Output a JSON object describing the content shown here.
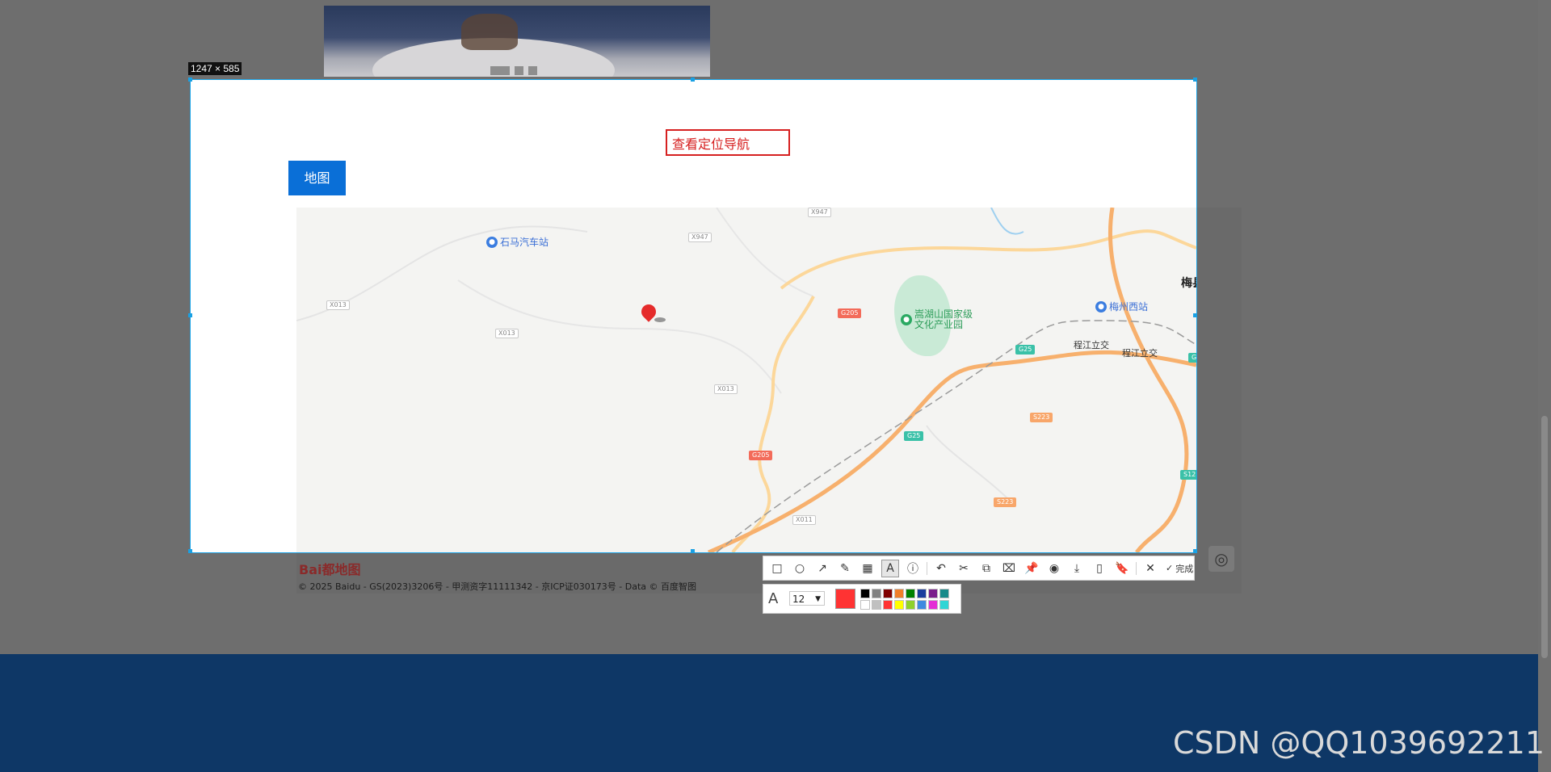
{
  "screenshot_tool": {
    "size_badge": "1247 × 585",
    "toolbar": {
      "tools": [
        {
          "name": "rectangle-icon",
          "glyph": "□"
        },
        {
          "name": "ellipse-icon",
          "glyph": "○"
        },
        {
          "name": "arrow-icon",
          "glyph": "↗"
        },
        {
          "name": "pencil-icon",
          "glyph": "✎"
        },
        {
          "name": "mosaic-icon",
          "glyph": "▦"
        },
        {
          "name": "text-icon",
          "glyph": "A"
        },
        {
          "name": "number-icon",
          "glyph": "ⓘ"
        },
        {
          "name": "undo-icon",
          "glyph": "↶"
        },
        {
          "name": "scissors-icon",
          "glyph": "✂"
        },
        {
          "name": "ocr-icon",
          "glyph": "⧉"
        },
        {
          "name": "translate-icon",
          "glyph": "⌧"
        },
        {
          "name": "pin-icon",
          "glyph": "📌"
        },
        {
          "name": "record-icon",
          "glyph": "◉"
        },
        {
          "name": "download-icon",
          "glyph": "⤓"
        },
        {
          "name": "phone-icon",
          "glyph": "▯"
        },
        {
          "name": "bookmark-icon",
          "glyph": "🔖"
        },
        {
          "name": "close-icon",
          "glyph": "✕"
        }
      ],
      "done_check": "✓",
      "done_label": "完成"
    },
    "text_options": {
      "font_icon": "A",
      "font_size": "12",
      "current_color": "#ff3333",
      "swatches": [
        "#000000",
        "#808080",
        "#800000",
        "#f07f2a",
        "#008000",
        "#1a3e9e",
        "#7a1f8c",
        "#188a8a",
        "#ffffff",
        "#c0c0c0",
        "#ff3333",
        "#ffff00",
        "#8fd12b",
        "#3f8ae0",
        "#e42fd5",
        "#2fd5d5"
      ]
    }
  },
  "page": {
    "nav_text": "查看定位导航",
    "map_button": "地图",
    "map": {
      "places": [
        "梅县区",
        "程江立交",
        "程江立交"
      ],
      "pois": [
        "石马汽车站",
        "梅州西站",
        "嵩湖山国家级",
        "文化产业园"
      ],
      "road_labels": [
        "X947",
        "X013",
        "X013",
        "X013",
        "G205",
        "G205",
        "G25",
        "G25",
        "S223",
        "S223",
        "X011",
        "S12",
        "G25",
        "X947"
      ],
      "logo": "Bai都地图",
      "copyright": "© 2025 Baidu - GS(2023)3206号 - 甲测资字11111342 - 京ICP证030173号 - Data © 百度智图"
    }
  },
  "watermark": "CSDN @QQ1039692211"
}
